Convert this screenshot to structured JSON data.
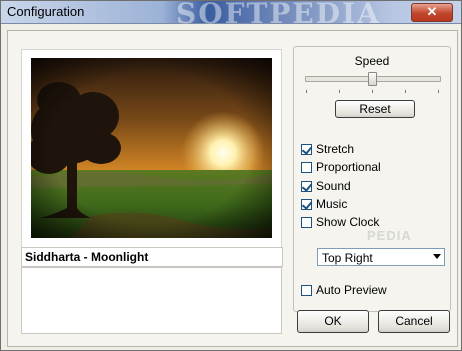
{
  "window": {
    "title": "Configuration",
    "watermark": "SOFTPEDIA",
    "close_glyph": "✕"
  },
  "preview": {
    "song_title": "Siddharta - Moonlight",
    "info_text": ""
  },
  "settings": {
    "speed_label": "Speed",
    "speed_level": 0.5,
    "reset_label": "Reset",
    "options": [
      {
        "label": "Stretch",
        "checked": true
      },
      {
        "label": "Proportional",
        "checked": false
      },
      {
        "label": "Sound",
        "checked": true
      },
      {
        "label": "Music",
        "checked": true
      },
      {
        "label": "Show Clock",
        "checked": false
      }
    ],
    "clock_position": "Top Right",
    "auto_preview": {
      "label": "Auto Preview",
      "checked": false
    },
    "ghost_mark": "PEDIA"
  },
  "buttons": {
    "ok": "OK",
    "cancel": "Cancel"
  },
  "colors": {
    "close_button": "#c0462c",
    "checkbox_border": "#1c5180"
  }
}
